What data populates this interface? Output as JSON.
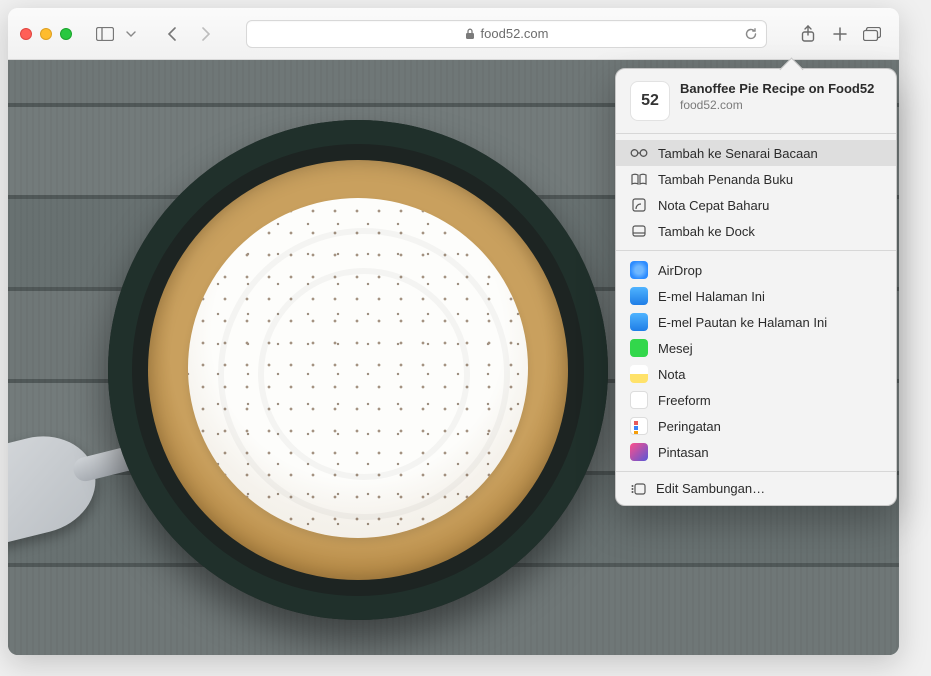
{
  "address_bar": {
    "domain": "food52.com"
  },
  "share": {
    "favicon_text": "52",
    "title": "Banoffee Pie Recipe on Food52",
    "subtitle": "food52.com",
    "items": [
      {
        "label": "Tambah ke Senarai Bacaan",
        "highlight": true
      },
      {
        "label": "Tambah Penanda Buku"
      },
      {
        "label": "Nota Cepat Baharu"
      },
      {
        "label": "Tambah ke Dock"
      }
    ],
    "apps": [
      {
        "label": "AirDrop"
      },
      {
        "label": "E-mel Halaman Ini"
      },
      {
        "label": "E-mel Pautan ke Halaman Ini"
      },
      {
        "label": "Mesej"
      },
      {
        "label": "Nota"
      },
      {
        "label": "Freeform"
      },
      {
        "label": "Peringatan"
      },
      {
        "label": "Pintasan"
      }
    ],
    "edit_label": "Edit Sambungan…"
  }
}
